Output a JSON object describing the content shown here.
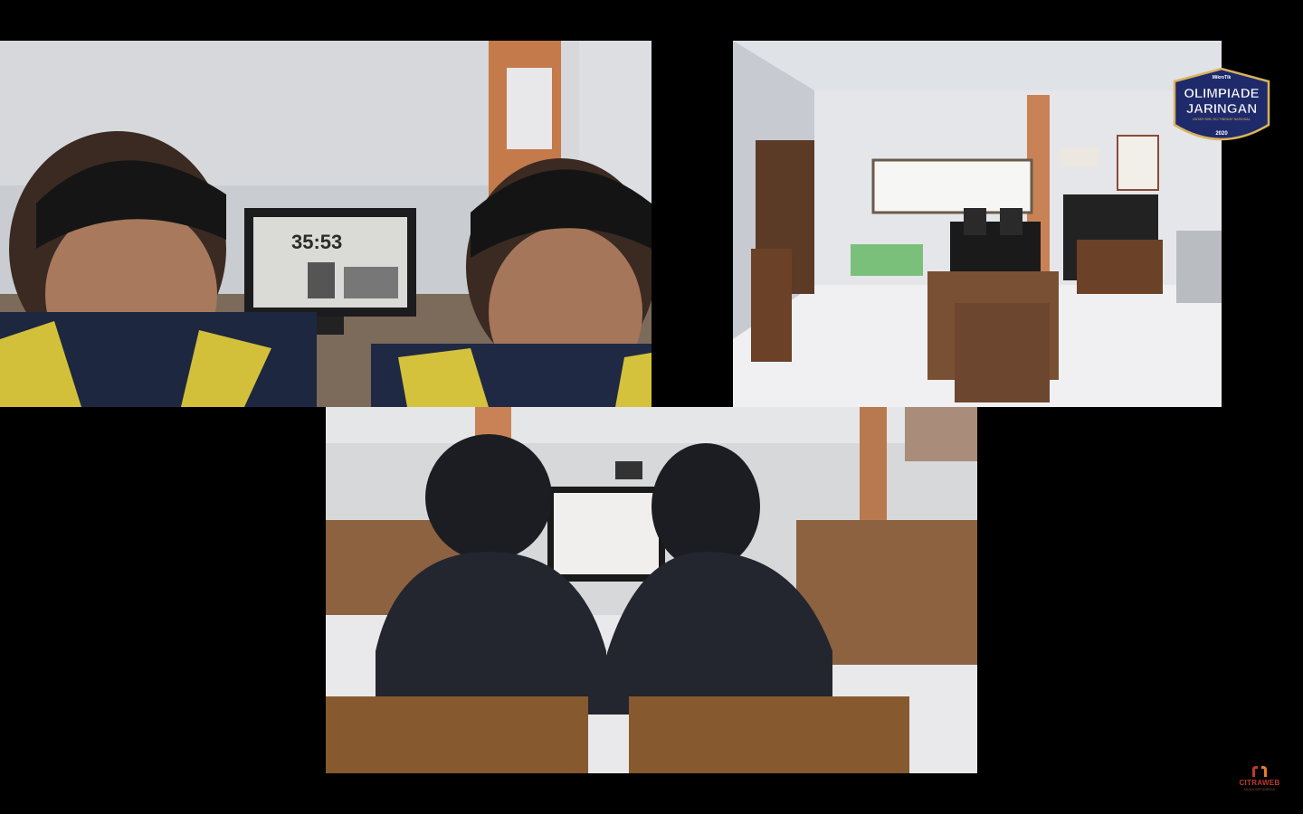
{
  "tiles": [
    {
      "id": "participant-1",
      "clock_text": "35:53"
    },
    {
      "id": "participant-2"
    },
    {
      "id": "participant-3"
    }
  ],
  "logo": {
    "brand": "MikroTik",
    "line1": "OLIMPIADE",
    "line2": "JARINGAN",
    "tagline": "ANTAR SMK-TKJ TINGKAT NASIONAL",
    "year": "2020"
  },
  "watermark": {
    "brand": "CITRAWEB",
    "sub": "NUSA INFOMEDIA"
  },
  "colors": {
    "background": "#000000",
    "logo_navy": "#1f2a6b",
    "logo_gold": "#d9b35c",
    "watermark_red": "#c0392b"
  }
}
